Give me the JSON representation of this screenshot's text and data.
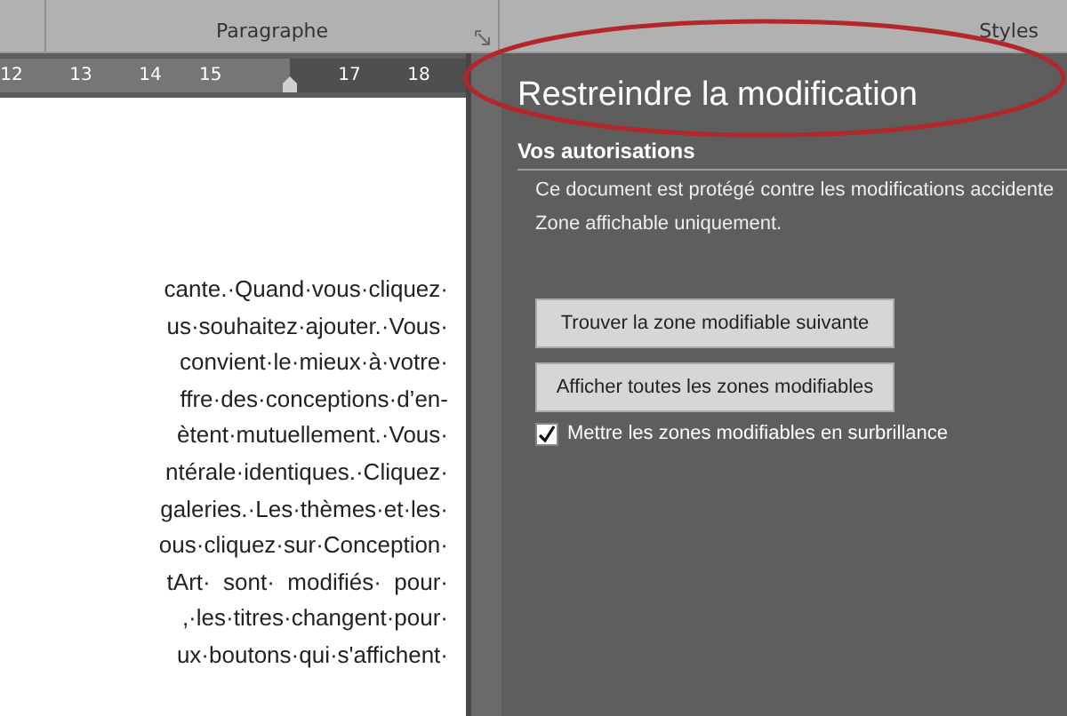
{
  "ribbon": {
    "groups": [
      {
        "label": "Paragraphe",
        "launcher": true
      },
      {
        "label": "Styles"
      }
    ]
  },
  "ruler": {
    "numbers": [
      "12",
      "13",
      "14",
      "15",
      "17",
      "18"
    ]
  },
  "document": {
    "lines": [
      "cante.·Quand·vous·cliquez·",
      "us·souhaitez·ajouter.·Vous·",
      "convient·le·mieux·à·votre·",
      "ffre·des·conceptions·d’en-",
      "ètent·mutuellement.·Vous·",
      "ntérale·identiques.·Cliquez·",
      "galeries.·Les·thèmes·et·les·",
      "ous·cliquez·sur·Conception·",
      "tArt·  sont·  modifiés·  pour·",
      ",·les·titres·changent·pour·",
      "ux·boutons·qui·s'affichent·"
    ]
  },
  "pane": {
    "title": "Restreindre la modification",
    "section": "Vos autorisations",
    "messages": [
      "Ce document est protégé contre les modifications accidente",
      "Zone affichable uniquement."
    ],
    "buttons": [
      "Trouver la zone modifiable suivante",
      "Afficher toutes les zones modifiables"
    ],
    "checkbox": {
      "label": "Mettre les zones modifiables en surbrillance",
      "checked": true
    }
  }
}
